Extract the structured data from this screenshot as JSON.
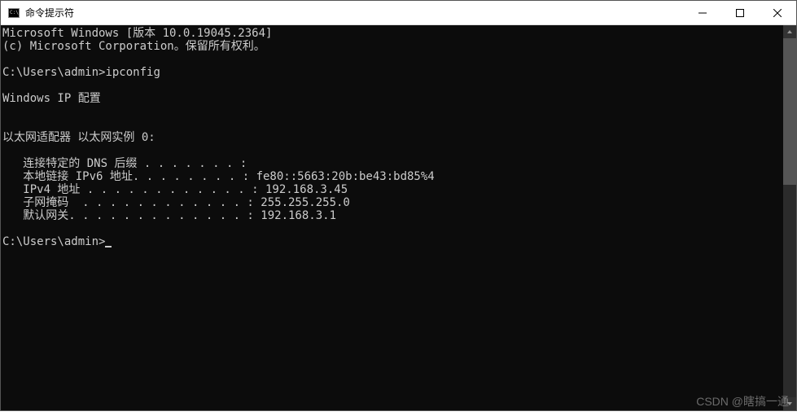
{
  "window": {
    "title": "命令提示符"
  },
  "terminal": {
    "line1": "Microsoft Windows [版本 10.0.19045.2364]",
    "line2": "(c) Microsoft Corporation。保留所有权利。",
    "blank1": "",
    "prompt1_path": "C:\\Users\\admin>",
    "prompt1_cmd": "ipconfig",
    "blank2": "",
    "header": "Windows IP 配置",
    "blank3": "",
    "blank4": "",
    "adapter": "以太网适配器 以太网实例 0:",
    "blank5": "",
    "dns_suffix": "   连接特定的 DNS 后缀 . . . . . . . :",
    "ipv6_link": "   本地链接 IPv6 地址. . . . . . . . : fe80::5663:20b:be43:bd85%4",
    "ipv4": "   IPv4 地址 . . . . . . . . . . . . : 192.168.3.45",
    "subnet": "   子网掩码  . . . . . . . . . . . . : 255.255.255.0",
    "gateway": "   默认网关. . . . . . . . . . . . . : 192.168.3.1",
    "blank6": "",
    "prompt2_path": "C:\\Users\\admin>"
  },
  "watermark": "CSDN @瞎搞一通"
}
